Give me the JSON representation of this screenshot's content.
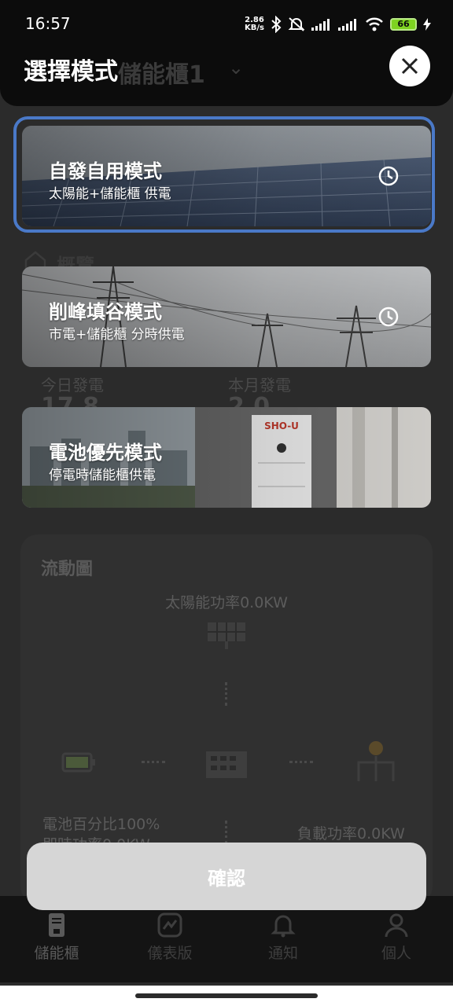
{
  "status_bar": {
    "time": "16:57",
    "net_speed_value": "2.86",
    "net_speed_unit": "KB/s",
    "battery_level": "66"
  },
  "background": {
    "site_title": "儲能櫃1",
    "overview_label": "概覽",
    "today_generation_label": "今日發電",
    "today_generation_value": "17.8",
    "month_generation_label": "本月發電",
    "month_generation_value": "2.0",
    "flow_chart_title": "流動圖",
    "solar_power": "太陽能功率0.0KW",
    "battery_percent": "電池百分比100%",
    "instant_power": "即時功率0.0KW",
    "load_power": "負載功率0.0KW",
    "nav": [
      {
        "label": "儲能櫃",
        "icon": "storage-cabinet-icon"
      },
      {
        "label": "儀表版",
        "icon": "dashboard-icon"
      },
      {
        "label": "通知",
        "icon": "bell-icon"
      },
      {
        "label": "個人",
        "icon": "person-icon"
      }
    ]
  },
  "modal": {
    "title": "選擇模式",
    "close_icon": "close-icon",
    "modes": [
      {
        "title": "自發自用模式",
        "subtitle": "太陽能+儲能櫃 供電",
        "selected": true,
        "has_schedule": true
      },
      {
        "title": "削峰填谷模式",
        "subtitle": "市電+儲能櫃 分時供電",
        "selected": false,
        "has_schedule": true
      },
      {
        "title": "電池優先模式",
        "subtitle": "停電時儲能櫃供電",
        "selected": false,
        "has_schedule": false
      }
    ],
    "confirm_label": "確認"
  },
  "colors": {
    "selected_ring": "#4a79c8",
    "confirm_bg": "#d6d6d6",
    "battery_green": "#7ed321"
  }
}
